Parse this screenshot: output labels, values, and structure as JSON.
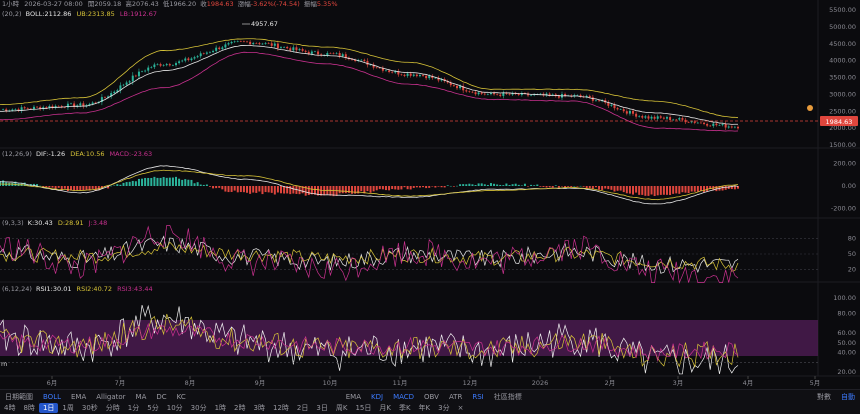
{
  "info": {
    "interval": "1小時",
    "datetime": "2026-03-27 08:00",
    "open_label": "開",
    "open": "2059.18",
    "high_label": "高",
    "high": "2076.43",
    "low_label": "低",
    "low": "1966.20",
    "close_label": "收",
    "close": "1984.63",
    "change_label": "漲幅",
    "change": "-3.62%(-74.54)",
    "amp_label": "振幅",
    "amp": "5.35%"
  },
  "boll": {
    "params": "(20,2)",
    "label": "BOLL:2112.86",
    "ub": "UB:2313.85",
    "lb": "LB:1912.67"
  },
  "macd_hdr": {
    "params": "(12,26,9)",
    "dif": "DIF:-1.26",
    "dea": "DEA:10.56",
    "macd": "MACD:-23.63"
  },
  "kdj_hdr": {
    "params": "(9,3,3)",
    "k": "K:30.43",
    "d": "D:28.91",
    "j": "J:3.48"
  },
  "rsi_hdr": {
    "params": "(6,12,24)",
    "rsi1": "RSI1:30.01",
    "rsi2": "RSI2:40.72",
    "rsi3": "RSI3:43.44"
  },
  "peak_label": "4957.67",
  "last_price_tag": "1984.63",
  "price_axis": [
    "5500.00",
    "5000.00",
    "4500.00",
    "4000.00",
    "3500.00",
    "3000.00",
    "2500.00",
    "2000.00",
    "1500.00"
  ],
  "macd_axis": [
    "200.00",
    "0.00",
    "-200.00"
  ],
  "kdj_axis": [
    "80",
    "50",
    "20"
  ],
  "rsi_axis": [
    "80.00",
    "60.00",
    "40.00",
    "20.00"
  ],
  "rsi_axis_top": "100.00",
  "rsi_axis_mid": "50.00",
  "months": [
    "6月",
    "7月",
    "8月",
    "9月",
    "10月",
    "11月",
    "12月",
    "2026",
    "2月",
    "3月",
    "4月",
    "5月"
  ],
  "time_axis_left_label": "m",
  "toolbar1": {
    "items": [
      "日期範圍",
      "BOLL",
      "EMA",
      "Alligator",
      "MA",
      "DC",
      "KC",
      "EMA",
      "KDJ",
      "MACD",
      "OBV",
      "ATR",
      "RSI",
      "社區指標"
    ],
    "active": [
      "BOLL",
      "KDJ",
      "MACD",
      "RSI"
    ],
    "right": [
      "對數",
      "自動"
    ]
  },
  "toolbar2": {
    "items": [
      "4時",
      "8時",
      "1日",
      "1周",
      "30秒",
      "分時",
      "1分",
      "5分",
      "10分",
      "30分",
      "1時",
      "2時",
      "3時",
      "12時",
      "2日",
      "3日",
      "周K",
      "15日",
      "月K",
      "季K",
      "年K",
      "3分",
      "×"
    ],
    "selected": "1日"
  },
  "colors": {
    "up": "#2bb39a",
    "down": "#e0463d",
    "boll_mid": "#e8e8e8",
    "boll_up": "#d8c438",
    "boll_low": "#c9318f",
    "rsi_band": "#4a1b4f",
    "last_tag": "#e0463d"
  },
  "chart_data": [
    {
      "type": "line",
      "title": "",
      "description_unit": "price",
      "x": [
        "6月",
        "7月",
        "8月",
        "9月",
        "10月",
        "11月",
        "12月",
        "2026",
        "2月",
        "3月"
      ],
      "series": [
        {
          "name": "Close",
          "values": [
            2550,
            2680,
            3900,
            4550,
            4200,
            3600,
            3000,
            2950,
            2300,
            2050
          ]
        },
        {
          "name": "BOLL",
          "values": [
            2500,
            2650,
            3700,
            4450,
            4150,
            3650,
            3050,
            2950,
            2450,
            2112.86
          ]
        },
        {
          "name": "UB",
          "values": [
            2700,
            2900,
            4300,
            4650,
            4400,
            3950,
            3150,
            3150,
            2800,
            2313.85
          ]
        },
        {
          "name": "LB",
          "values": [
            2250,
            2450,
            3200,
            4250,
            3900,
            3300,
            2850,
            2800,
            2000,
            1912.67
          ]
        }
      ],
      "ylim": [
        1500,
        5500
      ],
      "last_price": 1984.63,
      "peak": 4957.67
    },
    {
      "type": "bar",
      "title": "",
      "x": [
        "6月",
        "7月",
        "8月",
        "9月",
        "10月",
        "11月",
        "12月",
        "2026",
        "2月",
        "3月"
      ],
      "series": [
        {
          "name": "DIF",
          "values": [
            40,
            -60,
            180,
            60,
            -80,
            -100,
            -30,
            -20,
            -160,
            -1.26
          ]
        },
        {
          "name": "DEA",
          "values": [
            20,
            -40,
            140,
            90,
            -40,
            -90,
            -40,
            -15,
            -120,
            10.56
          ]
        },
        {
          "name": "MACD",
          "values": [
            40,
            -40,
            80,
            -60,
            -80,
            -20,
            20,
            -10,
            -80,
            -23.63
          ]
        }
      ],
      "ylim": [
        -250,
        250
      ]
    },
    {
      "type": "line",
      "title": "",
      "x": [
        "6月",
        "7月",
        "8月",
        "9月",
        "10月",
        "11月",
        "12月",
        "2026",
        "2月",
        "3月"
      ],
      "series": [
        {
          "name": "K",
          "values": [
            55,
            40,
            70,
            45,
            35,
            50,
            40,
            55,
            30,
            30.43
          ]
        },
        {
          "name": "D",
          "values": [
            50,
            45,
            62,
            50,
            42,
            48,
            42,
            50,
            35,
            28.91
          ]
        },
        {
          "name": "J",
          "values": [
            65,
            25,
            90,
            35,
            20,
            55,
            35,
            65,
            15,
            3.48
          ]
        }
      ],
      "ylim": [
        0,
        100
      ]
    },
    {
      "type": "line",
      "title": "",
      "x": [
        "6月",
        "7月",
        "8月",
        "9月",
        "10月",
        "11月",
        "12月",
        "2026",
        "2月",
        "3月"
      ],
      "series": [
        {
          "name": "RSI1",
          "values": [
            55,
            45,
            75,
            50,
            40,
            45,
            40,
            55,
            30,
            30.01
          ]
        },
        {
          "name": "RSI2",
          "values": [
            52,
            47,
            68,
            52,
            44,
            46,
            43,
            52,
            36,
            40.72
          ]
        },
        {
          "name": "RSI3",
          "values": [
            51,
            48,
            63,
            53,
            46,
            47,
            45,
            50,
            40,
            43.44
          ]
        }
      ],
      "ylim": [
        20,
        100
      ],
      "band": [
        30,
        70
      ]
    }
  ]
}
